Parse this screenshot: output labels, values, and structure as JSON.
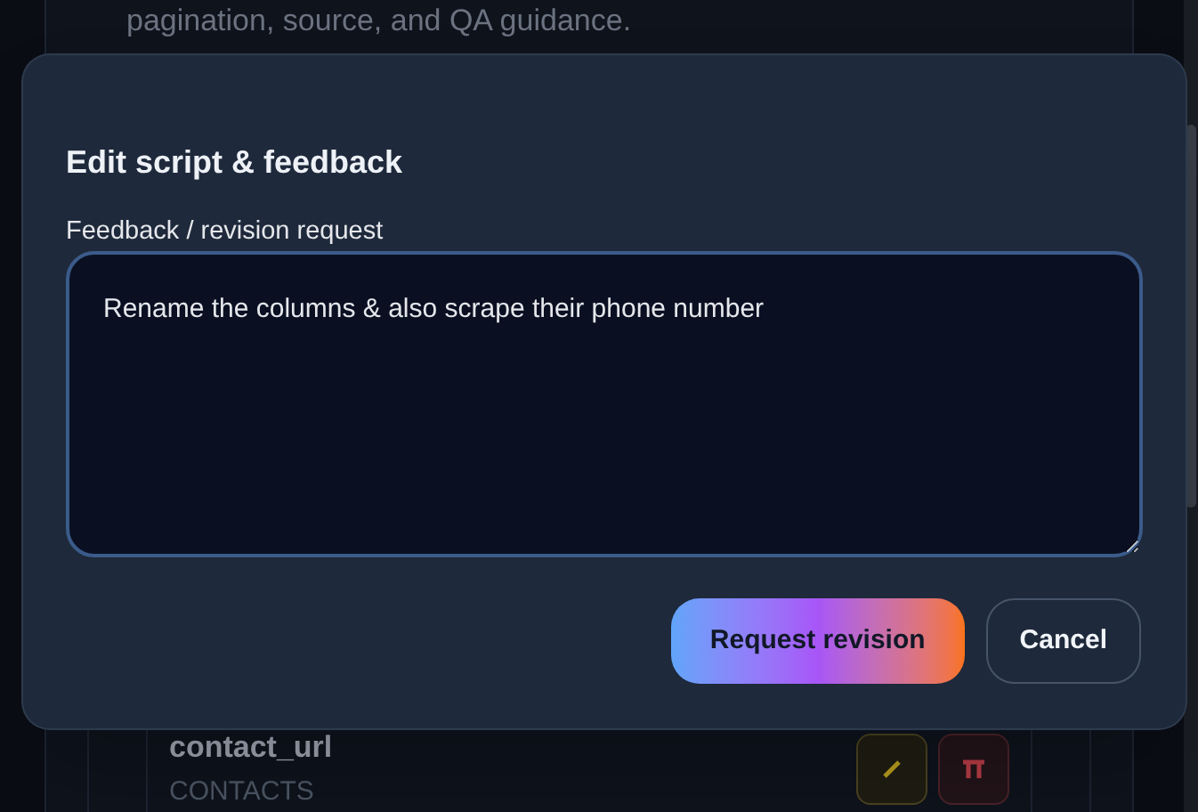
{
  "background": {
    "description": "pagination, source, and QA guidance.",
    "columns": [
      {
        "name": "contact_url",
        "source": "CONTACTS"
      }
    ]
  },
  "modal": {
    "title": "Edit script & feedback",
    "field_label": "Feedback / revision request",
    "value": "Rename the columns & also scrape their phone number",
    "buttons": [
      {
        "kind": "primary",
        "label": "Request revision"
      },
      {
        "kind": "secondary",
        "label": "Cancel"
      }
    ]
  }
}
